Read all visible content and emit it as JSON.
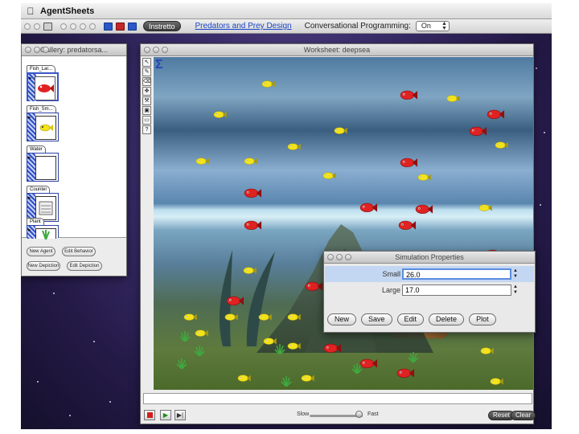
{
  "menubar": {
    "app_name": "AgentSheets"
  },
  "toolbar": {
    "instretto_label": "Instretto",
    "project_link": "Predators and Prey Design",
    "conversational_label": "Conversational Programming:",
    "conversational_value": "On"
  },
  "gallery": {
    "title": "Gallery: predatorsa...",
    "agents": [
      {
        "label": "Fish_Lar..."
      },
      {
        "label": "Fish_Sm..."
      },
      {
        "label": "Water"
      },
      {
        "label": "Counter"
      },
      {
        "label": "Plant"
      }
    ],
    "buttons": {
      "new_agent": "New Agent",
      "edit_behavior": "Edit Behavior",
      "new_depiction": "New Depiction",
      "edit_depiction": "Edit Depiction"
    }
  },
  "worksheet": {
    "title": "Worksheet: deepsea",
    "sigma": "Σ",
    "tools": [
      "↖",
      "✎",
      "⌫",
      "✥",
      "⚒",
      "▣",
      "▭",
      "?"
    ],
    "speed": {
      "slow_label": "Slow",
      "fast_label": "Fast",
      "level": 0.92
    },
    "reset_label": "Reset",
    "clear_label": "Clear"
  },
  "simulation_properties": {
    "title": "Simulation Properties",
    "rows": [
      {
        "label": "Small",
        "value": "26.0"
      },
      {
        "label": "Large",
        "value": "17.0"
      }
    ],
    "buttons": [
      "New",
      "Save",
      "Edit",
      "Delete",
      "Plot"
    ]
  },
  "colors": {
    "link": "#1b46c7",
    "selection": "#c4d7f2",
    "fish_large": "#e02222",
    "fish_small": "#f2e31a",
    "plant": "#3fa83f"
  },
  "icons": [
    "apple-icon",
    "folder-icon",
    "save-icon",
    "sigma-icon",
    "arrow-tool-icon",
    "pencil-tool-icon",
    "eraser-tool-icon",
    "hammer-tool-icon",
    "stop-icon",
    "play-icon",
    "step-icon"
  ]
}
